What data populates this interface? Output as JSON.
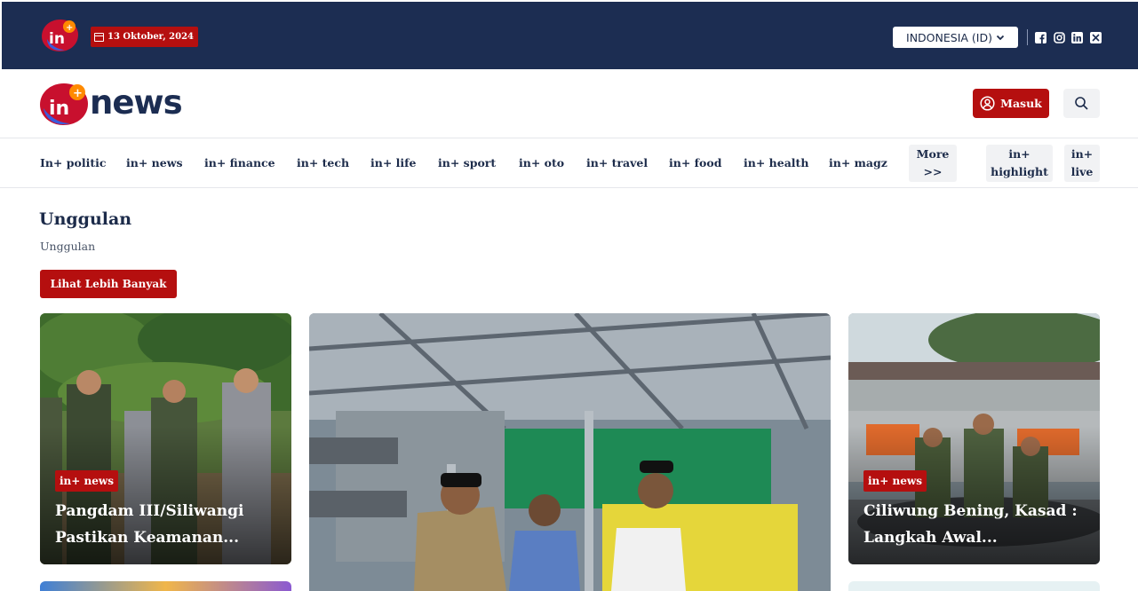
{
  "topbar": {
    "date": "13 Oktober, 2024",
    "region": "INDONESIA (ID)",
    "social_icons": [
      "facebook-icon",
      "instagram-icon",
      "linkedin-icon",
      "x-icon"
    ]
  },
  "header": {
    "brand_word": "news",
    "login_label": "Masuk"
  },
  "nav": {
    "items": [
      "In+ politic",
      "in+ news",
      "in+ finance",
      "in+ tech",
      "in+ life",
      "in+ sport",
      "in+ oto",
      "in+ travel",
      "in+ food",
      "in+ health",
      "in+ magz"
    ],
    "more_line1": "More",
    "more_line2": ">>",
    "highlight_line1": "in+",
    "highlight_line2": "highlight",
    "live_line1": "in+",
    "live_line2": "live"
  },
  "section": {
    "title": "Unggulan",
    "subtitle": "Unggulan",
    "more_button": "Lihat Lebih Banyak"
  },
  "cards": [
    {
      "category": "in+ news",
      "headline_line1": "Pangdam III/Siliwangi",
      "headline_line2": "Pastikan Keamanan..."
    },
    {
      "category": "in+ news",
      "headline_line1": "Ciliwung Bening, Kasad :",
      "headline_line2": "Langkah Awal..."
    }
  ],
  "colors": {
    "topbar": "#1c2d52",
    "accent": "#b50f0f",
    "text": "#1c2b4a"
  }
}
